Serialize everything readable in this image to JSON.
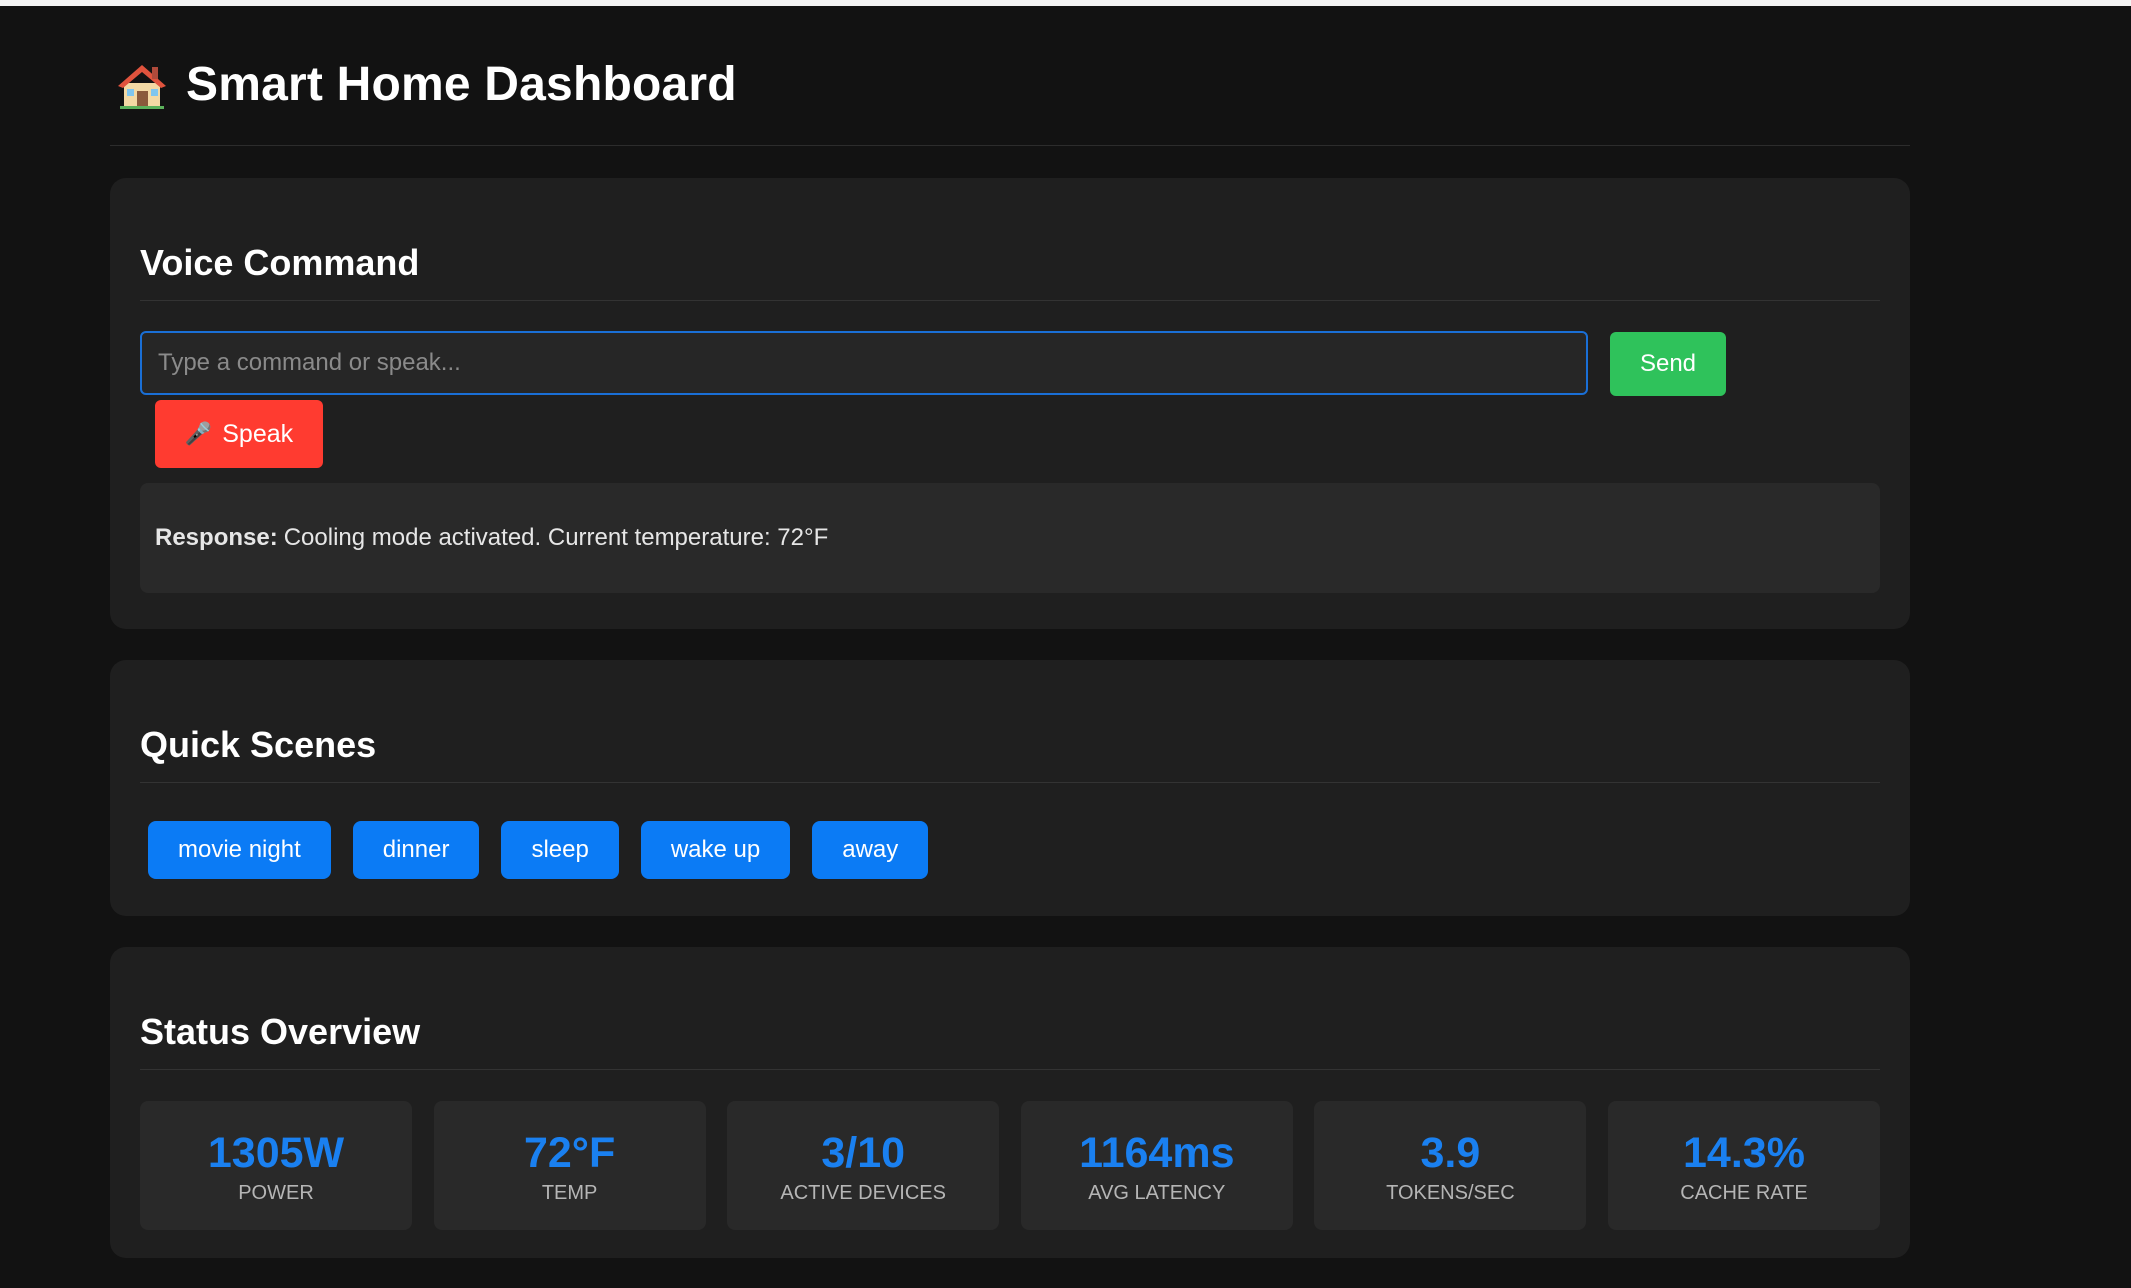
{
  "header": {
    "icon": "house-icon",
    "title": "Smart Home Dashboard"
  },
  "voice": {
    "title": "Voice Command",
    "input_value": "",
    "input_placeholder": "Type a command or speak...",
    "send_label": "Send",
    "speak_icon": "microphone-icon",
    "speak_label": "Speak",
    "response_label": "Response:",
    "response_text": "Cooling mode activated. Current temperature: 72°F"
  },
  "scenes": {
    "title": "Quick Scenes",
    "items": [
      {
        "label": "movie night"
      },
      {
        "label": "dinner"
      },
      {
        "label": "sleep"
      },
      {
        "label": "wake up"
      },
      {
        "label": "away"
      }
    ]
  },
  "status": {
    "title": "Status Overview",
    "stats": [
      {
        "value": "1305W",
        "label": "POWER"
      },
      {
        "value": "72°F",
        "label": "TEMP"
      },
      {
        "value": "3/10",
        "label": "ACTIVE DEVICES"
      },
      {
        "value": "1164ms",
        "label": "AVG LATENCY"
      },
      {
        "value": "3.9",
        "label": "TOKENS/SEC"
      },
      {
        "value": "14.3%",
        "label": "CACHE RATE"
      }
    ]
  },
  "colors": {
    "background": "#121212",
    "card": "#1f1f1f",
    "accent_blue": "#0b7bf5",
    "send_green": "#2fc25b",
    "speak_red": "#ff3b30"
  }
}
